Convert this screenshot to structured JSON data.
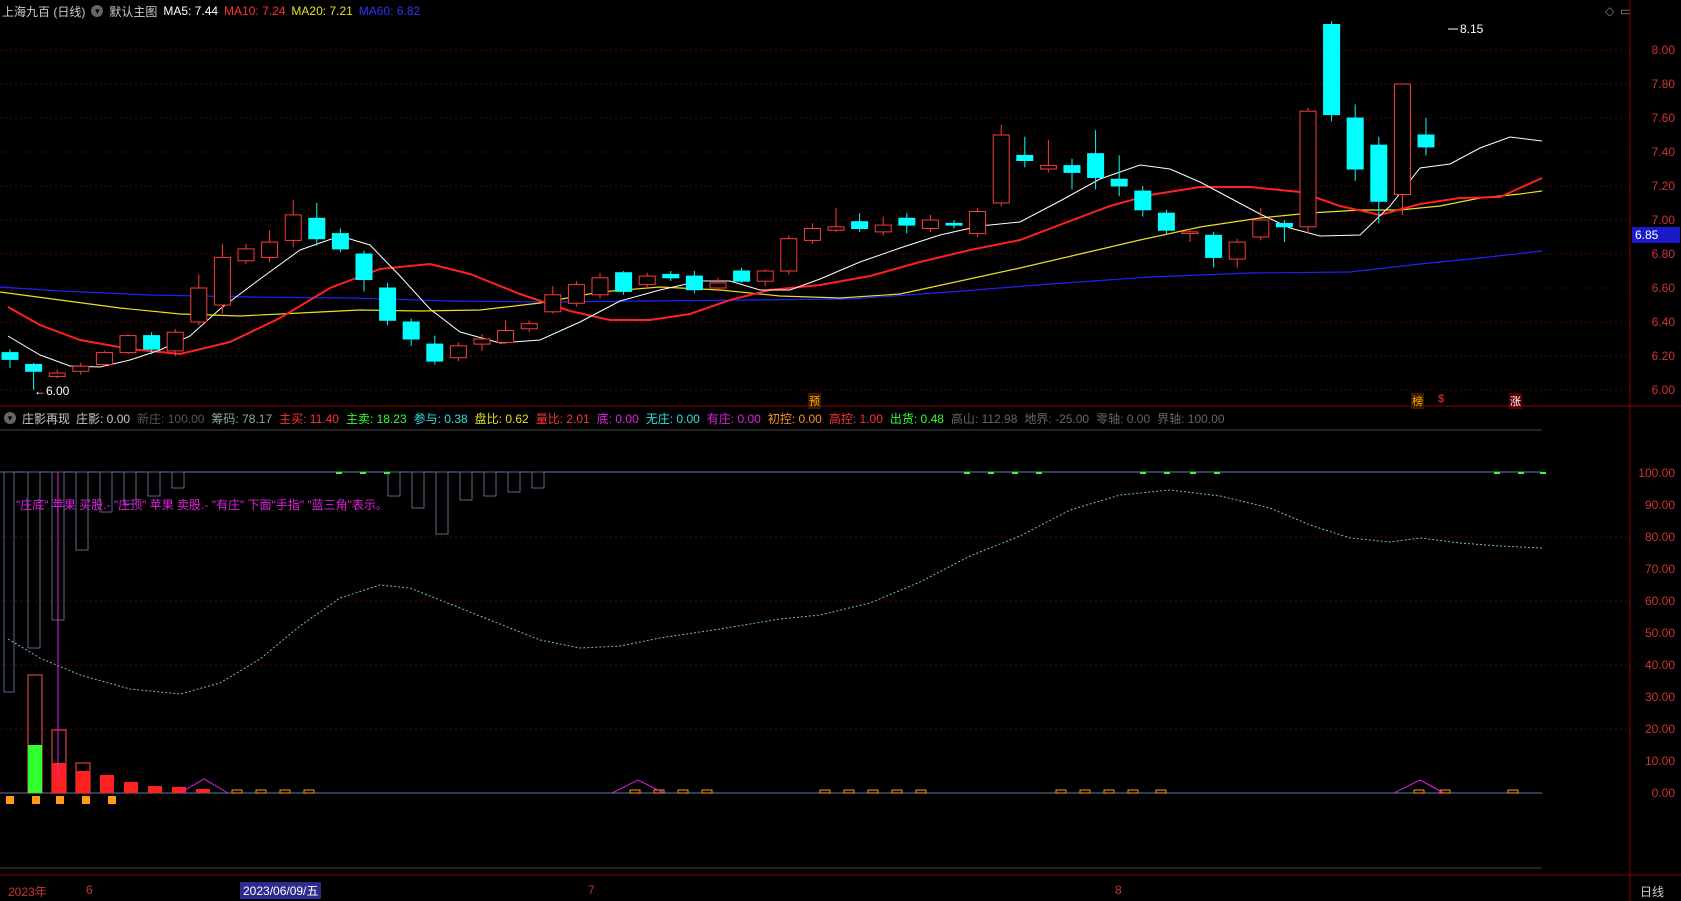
{
  "header": {
    "stock": "上海九百 (日线)",
    "template": "默认主图",
    "ma5": "MA5: 7.44",
    "ma10": "MA10: 7.24",
    "ma20": "MA20: 7.21",
    "ma60": "MA60: 6.82"
  },
  "price_axis": [
    "8.00",
    "7.80",
    "7.60",
    "7.40",
    "7.20",
    "7.00",
    "6.80",
    "6.60",
    "6.40",
    "6.20",
    "6.00"
  ],
  "current_price": "6.85",
  "high_label": "8.15",
  "low_label": "←6.00",
  "markers": {
    "m1": "预",
    "m2": "榜",
    "m3": "$",
    "m4": "涨"
  },
  "indicator": {
    "name": "庄影再现",
    "fields": [
      {
        "text": "庄影: 0.00",
        "color": "#ccc"
      },
      {
        "text": "新庄: 100.00",
        "color": "#555"
      },
      {
        "text": "筹码: 78.17",
        "color": "#8aa"
      },
      {
        "text": "主买: 11.40",
        "color": "#ff3030"
      },
      {
        "text": "主卖: 18.23",
        "color": "#30ff30"
      },
      {
        "text": "参与: 0.38",
        "color": "#30e0e0"
      },
      {
        "text": "盘比: 0.62",
        "color": "#e0e020"
      },
      {
        "text": "量比: 2.01",
        "color": "#ff3030"
      },
      {
        "text": "底: 0.00",
        "color": "#e020e0"
      },
      {
        "text": "无庄: 0.00",
        "color": "#30e0e0"
      },
      {
        "text": "有庄: 0.00",
        "color": "#e020e0"
      },
      {
        "text": "初控: 0.00",
        "color": "#ff9020"
      },
      {
        "text": "高控: 1.00",
        "color": "#ff3030"
      },
      {
        "text": "出货: 0.48",
        "color": "#30ff30"
      },
      {
        "text": "高山: 112.98",
        "color": "#666"
      },
      {
        "text": "地界: -25.00",
        "color": "#666"
      },
      {
        "text": "零轴: 0.00",
        "color": "#666"
      },
      {
        "text": "界轴: 100.00",
        "color": "#666"
      }
    ],
    "note": "\"庄底\" 苹果 买股.- \"庄顶\" 苹果 卖股.- \"有庄\" 下面\"手指\" \"蓝三角\"表示。",
    "axis": [
      "100.00",
      "90.00",
      "80.00",
      "70.00",
      "60.00",
      "50.00",
      "40.00",
      "30.00",
      "20.00",
      "10.00",
      "0.00"
    ]
  },
  "dates": {
    "year": "2023年",
    "m6": "6",
    "selected": "2023/06/09/五",
    "m7": "7",
    "m8": "8"
  },
  "period_button": "日线",
  "colors": {
    "up": "#ff3b3b",
    "down": "#00ffff",
    "ma5": "#ffffff",
    "ma10": "#ff2020",
    "ma20": "#e8e020",
    "ma60": "#2020ff"
  }
}
